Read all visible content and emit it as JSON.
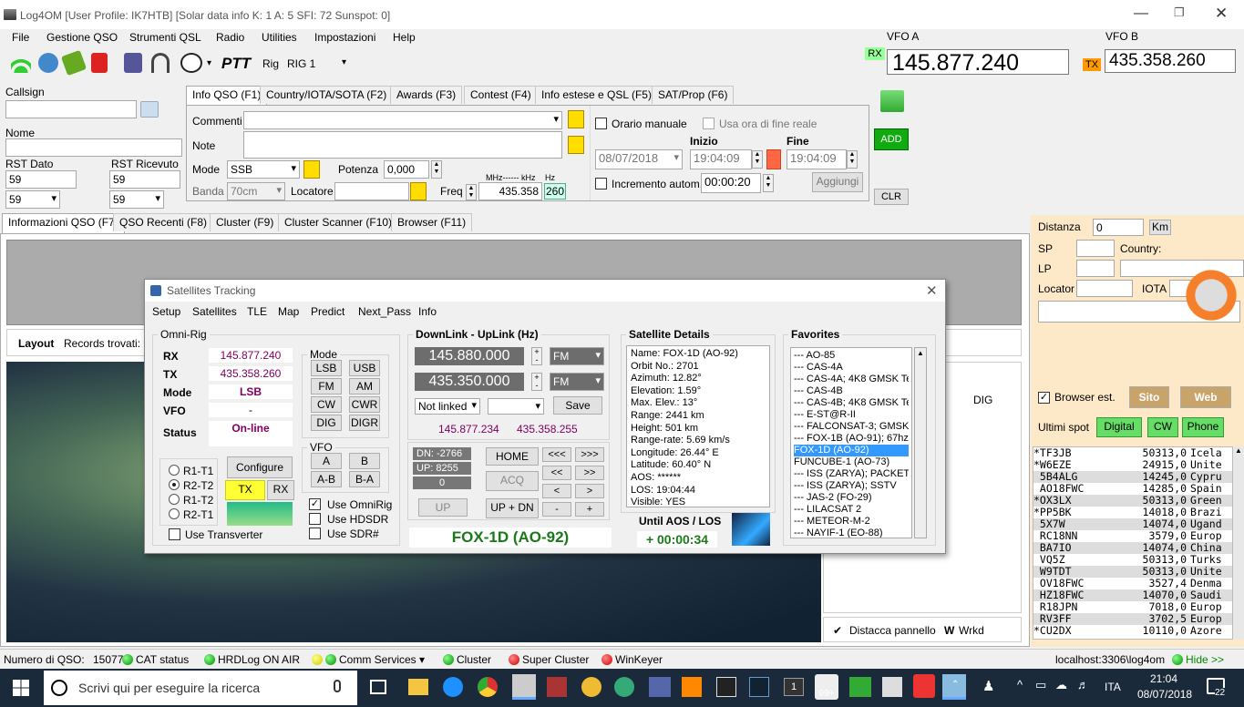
{
  "titlebar": {
    "text": "Log4OM [User Profile: IK7HTB] [Solar data info K: 1 A: 5 SFI: 72 Sunspot: 0]"
  },
  "menu": [
    "File",
    "Gestione QSO",
    "Strumenti QSL",
    "Radio",
    "Utilities",
    "Impostazioni",
    "Help"
  ],
  "toolbar": {
    "ptt": "PTT",
    "rig_label": "Rig",
    "rig_value": "RIG 1"
  },
  "vfo": {
    "a_label": "VFO A",
    "b_label": "VFO B",
    "rx_badge": "RX",
    "tx_badge": "TX",
    "a_freq": "145.877.240",
    "b_freq": "435.358.260"
  },
  "left": {
    "callsign_label": "Callsign",
    "callsign_value": "",
    "nome_label": "Nome",
    "nome_value": "",
    "rst_dato_label": "RST Dato",
    "rst_ric_label": "RST Ricevuto",
    "rst_dato_value": "59",
    "rst_ric_value": "59",
    "rst_dato_sel": "59",
    "rst_ric_sel": "59"
  },
  "qso_tabs": [
    "Info QSO (F1)",
    "Country/IOTA/SOTA (F2)",
    "Awards (F3)",
    "Contest (F4)",
    "Info estese e QSL (F5)",
    "SAT/Prop (F6)"
  ],
  "qso": {
    "commenti": "Commenti",
    "note": "Note",
    "mode_label": "Mode",
    "mode_value": "SSB",
    "potenza_label": "Potenza",
    "potenza_value": "0,000",
    "banda_label": "Banda",
    "banda_value": "70cm",
    "locatore_label": "Locatore",
    "freq_label": "Freq",
    "freq_unit": "MHz------ kHz",
    "hz_label": "Hz",
    "freq_value": "435.358",
    "hz_value": "260"
  },
  "time": {
    "orario_manuale": "Orario manuale",
    "usa_ora": "Usa ora di fine reale",
    "inizio_label": "Inizio",
    "fine_label": "Fine",
    "date": "08/07/2018",
    "start": "19:04:09",
    "end": "19:04:09",
    "incremento": "Incremento autom.",
    "incr_value": "00:00:20",
    "aggiungi": "Aggiungi",
    "add": "ADD",
    "clr": "CLR"
  },
  "main_tabs": [
    "Informazioni QSO (F7)",
    "QSO Recenti (F8)",
    "Cluster (F9)",
    "Cluster Scanner (F10)",
    "Browser (F11)"
  ],
  "layout_bar": {
    "layout": "Layout",
    "records": "Records trovati:"
  },
  "right": {
    "distanza": "Distanza",
    "distanza_value": "0",
    "km": "Km",
    "sp": "SP",
    "lp": "LP",
    "country": "Country:",
    "locator": "Locator",
    "iota": "IOTA",
    "browser_est": "Browser est.",
    "sito": "Sito",
    "web": "Web",
    "ultimi_spot": "Ultimi spot",
    "digital": "Digital",
    "cw": "CW",
    "phone": "Phone"
  },
  "spots": [
    {
      "call": "*TF3JB",
      "freq": "50313,0",
      "country": "Icela"
    },
    {
      "call": "*W6EZE",
      "freq": "24915,0",
      "country": "Unite"
    },
    {
      "call": " 5B4ALG",
      "freq": "14245,0",
      "country": "Cypru"
    },
    {
      "call": " AO18FWC",
      "freq": "14285,0",
      "country": "Spain"
    },
    {
      "call": "*OX3LX",
      "freq": "50313,0",
      "country": "Green"
    },
    {
      "call": "*PP5BK",
      "freq": "14018,0",
      "country": "Brazi"
    },
    {
      "call": " 5X7W",
      "freq": "14074,0",
      "country": "Ugand"
    },
    {
      "call": " RC18NN",
      "freq": "3579,0",
      "country": "Europ"
    },
    {
      "call": " BA7IO",
      "freq": "14074,0",
      "country": "China"
    },
    {
      "call": " VQ5Z",
      "freq": "50313,0",
      "country": "Turks"
    },
    {
      "call": " W9TDT",
      "freq": "50313,0",
      "country": "Unite"
    },
    {
      "call": " OV18FWC",
      "freq": "3527,4",
      "country": "Denma"
    },
    {
      "call": " HZ18FWC",
      "freq": "14070,0",
      "country": "Saudi"
    },
    {
      "call": " R18JPN",
      "freq": "7018,0",
      "country": "Europ"
    },
    {
      "call": " RV3FF",
      "freq": "3702,5",
      "country": "Europ"
    },
    {
      "call": "*CU2DX",
      "freq": "10110,0",
      "country": "Azore"
    }
  ],
  "cluster_panel": {
    "dig": "DIG",
    "distacca": "Distacca pannello",
    "wrkd": "Wrkd",
    "w": "W"
  },
  "sat": {
    "title": "Satellites Tracking",
    "menu": [
      "Setup",
      "Satellites",
      "TLE",
      "Map",
      "Predict",
      "Next_Pass",
      "Info"
    ],
    "omnirig_title": "Omni-Rig",
    "rx_label": "RX",
    "rx_value": "145.877.240",
    "tx_label": "TX",
    "tx_value": "435.358.260",
    "mode_label": "Mode",
    "mode_value": "LSB",
    "vfo_label": "VFO",
    "vfo_value": "-",
    "status_label": "Status",
    "status_value": "On-line",
    "radios": [
      "R1-T1",
      "R2-T2",
      "R1-T2",
      "R2-T1"
    ],
    "configure": "Configure",
    "tx_btn": "TX",
    "rx_btn": "RX",
    "use_transverter": "Use Transverter",
    "mode_title": "Mode",
    "modes": [
      "LSB",
      "USB",
      "FM",
      "AM",
      "CW",
      "CWR",
      "DIG",
      "DIGR"
    ],
    "vfo_title": "VFO",
    "vfo_btns": [
      "A",
      "B",
      "A-B",
      "B-A"
    ],
    "use_omnirig": "Use OmniRig",
    "use_hdsdr": "Use HDSDR",
    "use_sdr": "Use SDR#",
    "downlink_title": "DownLink - UpLink (Hz)",
    "down_freq": "145.880.000",
    "up_freq": "435.350.000",
    "down_mode": "FM",
    "up_mode": "FM",
    "not_linked": "Not linked",
    "save": "Save",
    "calc_down": "145.877.234",
    "calc_up": "435.358.255",
    "dn": "DN: -2766",
    "up": "UP: 8255",
    "zero": "0",
    "up_btn": "UP",
    "home": "HOME",
    "acq": "ACQ",
    "updn": "UP + DN",
    "nav": [
      "<<<",
      ">>>",
      "<<",
      ">>",
      "<",
      ">",
      "-",
      "+"
    ],
    "sat_name": "FOX-1D (AO-92)",
    "details_title": "Satellite Details",
    "details": [
      "Name: FOX-1D (AO-92)",
      "Orbit No.: 2701",
      "Azimuth: 12.82°",
      "Elevation: 1.59°",
      "Max. Elev.: 13°",
      "Range: 2441 km",
      "Height: 501 km",
      "Range-rate: 5.69 km/s",
      "Longitude: 26.44° E",
      "Latitude: 60.40° N",
      "AOS: ******",
      "LOS: 19:04:44",
      "Visible: YES"
    ],
    "until": "Until AOS / LOS",
    "countdown": "+ 00:00:34",
    "favorites_title": "Favorites",
    "favorites": [
      "--- AO-85",
      "--- CAS-4A",
      "--- CAS-4A; 4K8 GMSK Tele",
      "--- CAS-4B",
      "--- CAS-4B; 4K8 GMSK Tele",
      "--- E-ST@R-II",
      "--- FALCONSAT-3; GMSK 9",
      "--- FOX-1B (AO-91); 67hz C",
      "FOX-1D (AO-92)",
      "FUNCUBE-1 (AO-73)",
      "--- ISS (ZARYA); PACKET",
      "--- ISS (ZARYA); SSTV",
      "--- JAS-2 (FO-29)",
      "--- LILACSAT 2",
      "--- METEOR-M-2",
      "--- NAYIF-1 (EO-88)"
    ],
    "selected_index": 8
  },
  "statusbar": {
    "numero": "Numero di QSO:",
    "count": "15077",
    "cat": "CAT status",
    "hrdlog": "HRDLog ON AIR",
    "comm": "Comm Services",
    "cluster": "Cluster",
    "super": "Super Cluster",
    "winkeyer": "WinKeyer",
    "db": "localhost:3306\\log4om",
    "hide": "Hide >>"
  },
  "taskbar": {
    "search": "Scrivi qui per eseguire la ricerca",
    "lang": "ITA",
    "time": "21:04",
    "date": "08/07/2018",
    "badge": "99+",
    "notif": "22",
    "one": "1"
  }
}
